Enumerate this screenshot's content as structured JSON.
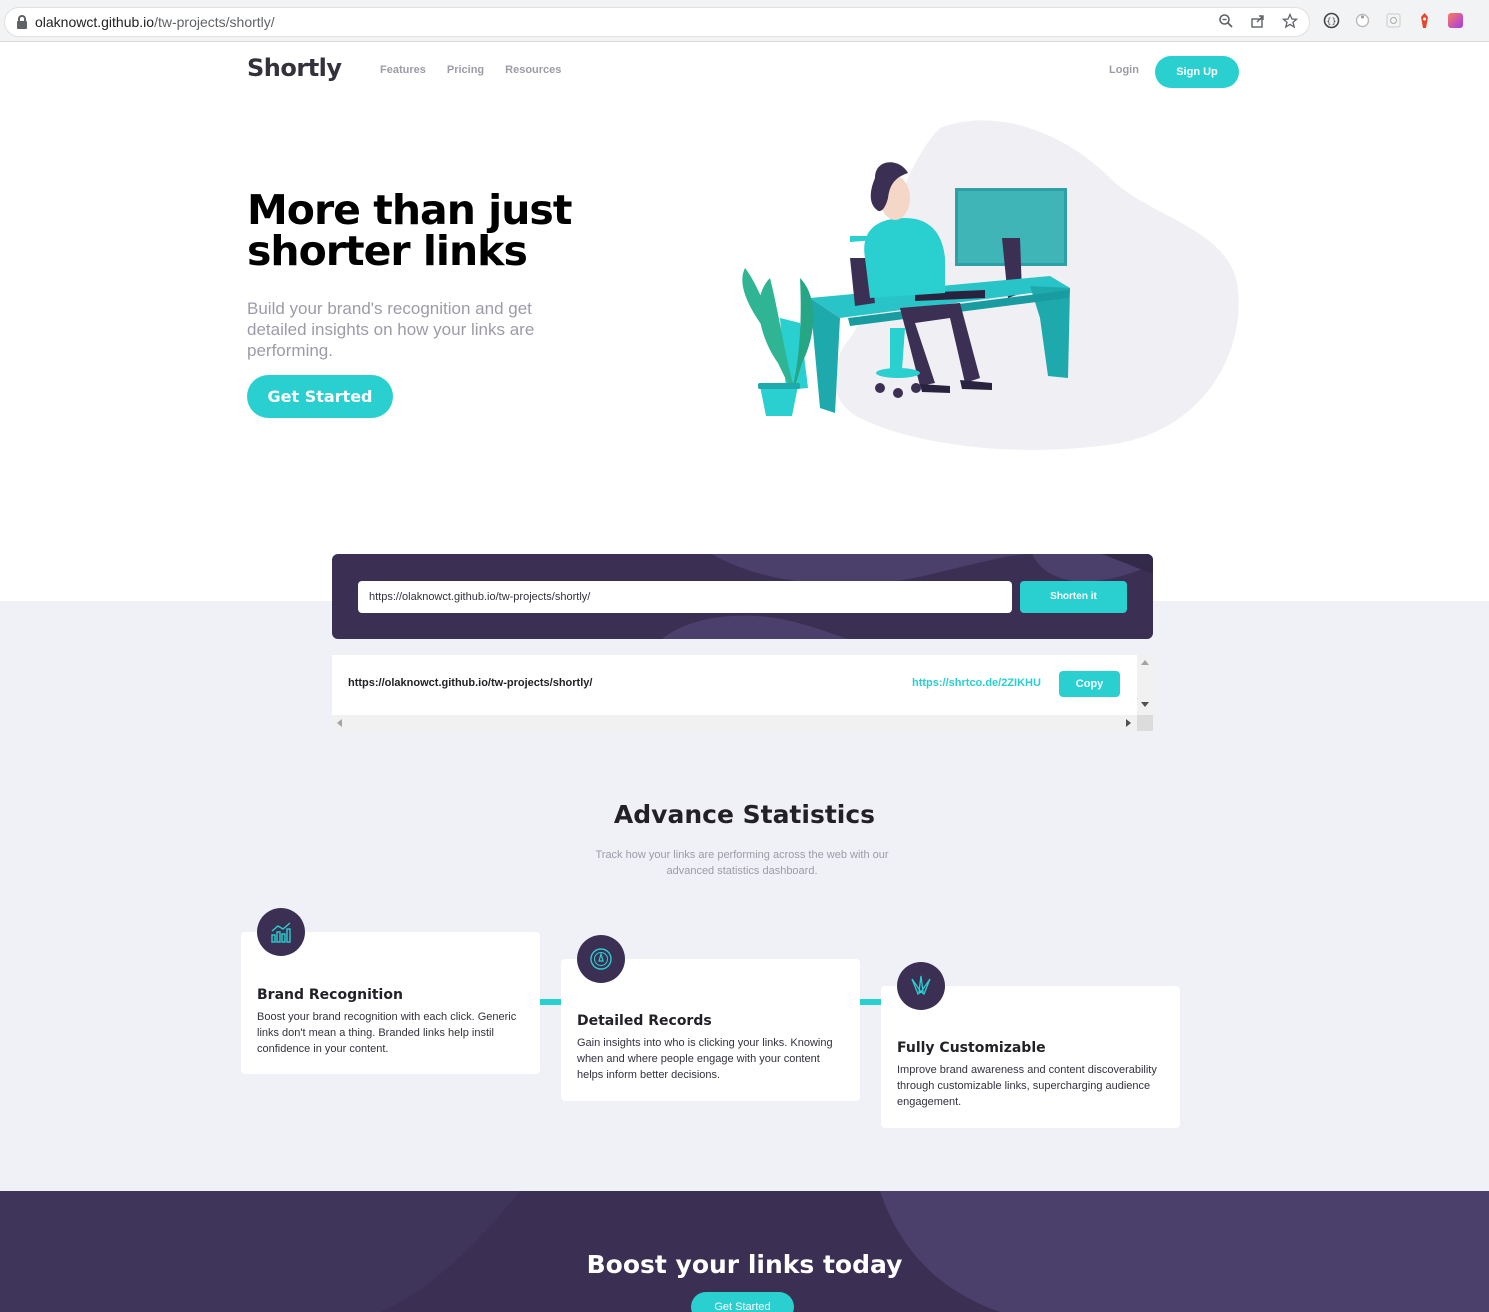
{
  "browser": {
    "url_domain": "olaknowct.github.io",
    "url_path": "/tw-projects/shortly/",
    "actions": [
      "zoom-icon",
      "share-icon",
      "star-icon"
    ],
    "extensions": [
      "extension-1-icon",
      "extension-2-icon",
      "extension-3-icon",
      "extension-4-icon",
      "extension-5-icon"
    ]
  },
  "header": {
    "logo": "Shortly",
    "nav": [
      "Features",
      "Pricing",
      "Resources"
    ],
    "login": "Login",
    "signup": "Sign Up"
  },
  "hero": {
    "title": "More than just shorter links",
    "subtitle": "Build your brand's recognition and get detailed insights on how your links are performing.",
    "cta": "Get Started"
  },
  "shortener": {
    "input_value": "https://olaknowct.github.io/tw-projects/shortly/",
    "button": "Shorten it"
  },
  "result": {
    "original": "https://olaknowct.github.io/tw-projects/shortly/",
    "short": "https://shrtco.de/2ZIKHU",
    "copy": "Copy"
  },
  "stats": {
    "title": "Advance Statistics",
    "subtitle": "Track how your links are performing across the web with our advanced statistics dashboard.",
    "cards": [
      {
        "icon": "brand-recognition-icon",
        "title": "Brand Recognition",
        "text": "Boost your brand recognition with each click. Generic links don't mean a thing. Branded links help instil confidence in your content."
      },
      {
        "icon": "detailed-records-icon",
        "title": "Detailed Records",
        "text": "Gain insights into who is clicking your links. Knowing when and where people engage with your content helps inform better decisions."
      },
      {
        "icon": "fully-customizable-icon",
        "title": "Fully Customizable",
        "text": "Improve brand awareness and content discoverability through customizable links, supercharging audience engagement."
      }
    ]
  },
  "boost": {
    "title": "Boost your links today",
    "cta": "Get Started"
  },
  "colors": {
    "cyan": "#2acfcf",
    "dark_violet": "#3b3054",
    "gray": "#9e9aa8",
    "light_bg": "#f0f1f6"
  }
}
